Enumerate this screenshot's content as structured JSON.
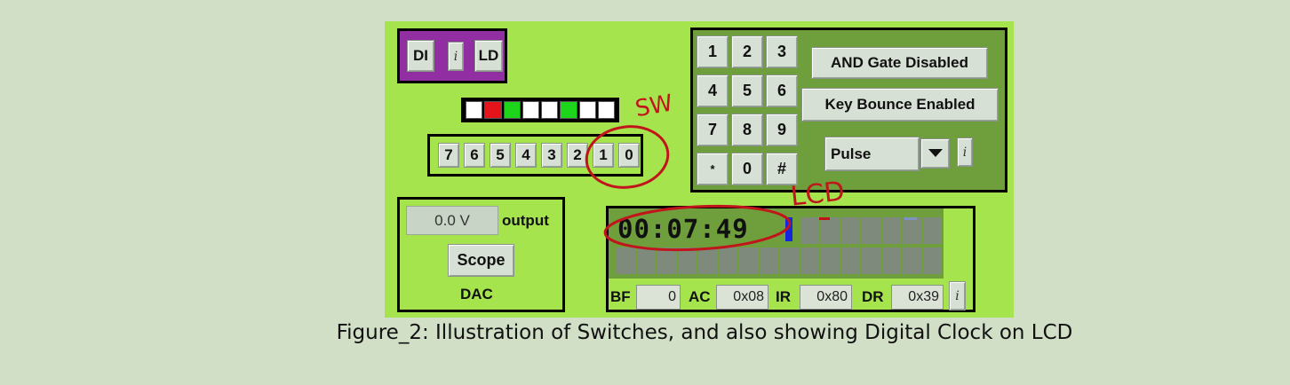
{
  "di_panel": {
    "di_label": "DI",
    "info_label": "i",
    "ld_label": "LD"
  },
  "leds": {
    "colors": [
      "#ffffff",
      "#e5141b",
      "#1ed51b",
      "#ffffff",
      "#ffffff",
      "#1ed51b",
      "#ffffff",
      "#ffffff"
    ]
  },
  "switches": [
    "7",
    "6",
    "5",
    "4",
    "3",
    "2",
    "1",
    "0"
  ],
  "keypad": {
    "keys": [
      "1",
      "2",
      "3",
      "4",
      "5",
      "6",
      "7",
      "8",
      "9",
      "*",
      "0",
      "#"
    ],
    "and_gate_label": "AND Gate Disabled",
    "key_bounce_label": "Key Bounce Enabled",
    "mode_select": "Pulse",
    "info_label": "i"
  },
  "dac": {
    "value": "0.0 V",
    "output_label": "output",
    "scope_label": "Scope",
    "title": "DAC"
  },
  "lcd": {
    "display_text": "00:07:49",
    "bf_label": "BF",
    "bf_value": "0",
    "ac_label": "AC",
    "ac_value": "0x08",
    "ir_label": "IR",
    "ir_value": "0x80",
    "dr_label": "DR",
    "dr_value": "0x39",
    "info_label": "i"
  },
  "annotations": {
    "sw_label": "SW",
    "lcd_label": "LCD",
    "color": "#c0161b"
  },
  "caption": "Figure_2: Illustration of Switches, and also showing Digital Clock on LCD"
}
